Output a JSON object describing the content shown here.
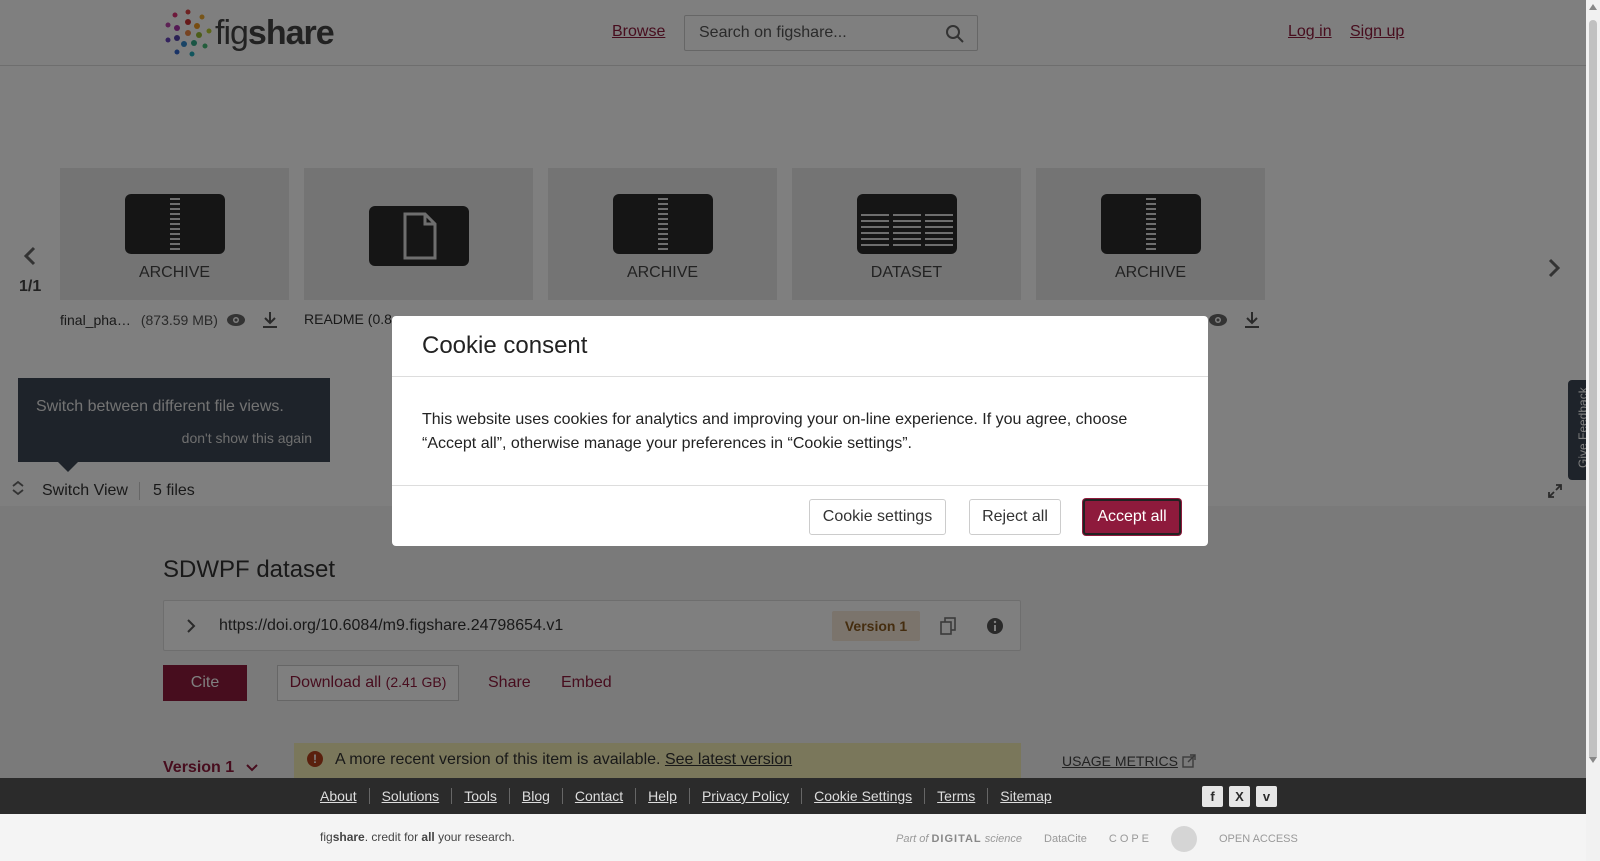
{
  "header": {
    "logo_prefix": "fig",
    "logo_suffix": "share",
    "browse": "Browse",
    "search_placeholder": "Search on figshare...",
    "login": "Log in",
    "signup": "Sign up"
  },
  "carousel": {
    "pager": "1/1",
    "cards": [
      {
        "type": "ARCHIVE"
      },
      {
        "type": ""
      },
      {
        "type": "ARCHIVE"
      },
      {
        "type": "DATASET"
      },
      {
        "type": "ARCHIVE"
      }
    ],
    "files": [
      {
        "name": "final_pha…",
        "size": "(873.59 MB)"
      },
      {
        "name": "README (0.8",
        "size": ""
      }
    ]
  },
  "tooltip": {
    "text": "Switch between different file views.",
    "dismiss": "don't show this again"
  },
  "switchbar": {
    "label": "Switch View",
    "count": "5 files"
  },
  "item": {
    "title": "SDWPF dataset",
    "doi": "https://doi.org/10.6084/m9.figshare.24798654.v1",
    "version_badge": "Version 1",
    "cite": "Cite",
    "download": "Download all",
    "download_size": "(2.41 GB)",
    "share": "Share",
    "embed": "Embed",
    "version_select": "Version 1",
    "notice_text": "A more recent version of this item is available.",
    "notice_link": "See latest version",
    "usage_metrics": "USAGE METRICS"
  },
  "feedback": "Give Feedback",
  "footer": {
    "links": [
      "About",
      "Solutions",
      "Tools",
      "Blog",
      "Contact",
      "Help",
      "Privacy Policy",
      "Cookie Settings",
      "Terms",
      "Sitemap"
    ],
    "social": [
      "f",
      "X",
      "v"
    ],
    "tagline_fig": "fig",
    "tagline_share": "share",
    "tagline_mid": ". credit for ",
    "tagline_all": "all",
    "tagline_end": " your research.",
    "partner_part_of": "Part of",
    "partner_ds": "DIGITAL",
    "partner_science": "science",
    "partner_datacite": "DataCite",
    "partner_cope": "C O P E",
    "partner_oa": "OPEN ACCESS"
  },
  "modal": {
    "title": "Cookie consent",
    "body": "This website uses cookies for analytics and improving your on-line experience. If you agree, choose “Accept all”, otherwise manage your preferences in “Cookie settings”.",
    "settings": "Cookie settings",
    "reject": "Reject all",
    "accept": "Accept all"
  },
  "colors": {
    "brand": "#8e1a3c",
    "footer_dark": "#2b2b2b",
    "notice_bg": "#f5efb6"
  }
}
